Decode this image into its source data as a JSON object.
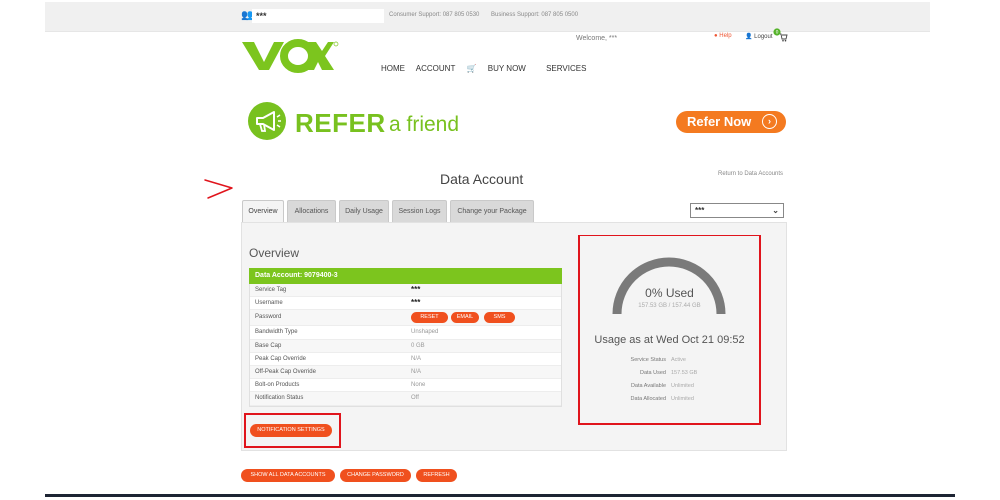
{
  "topbar": {
    "username_masked": "***",
    "consumer_support": "Consumer Support: 087 805 0530",
    "business_support": "Business Support: 087 805 0500"
  },
  "header": {
    "welcome": "Welcome, ***",
    "help_label": "Help",
    "logout_label": "Logout",
    "cart_count": "0"
  },
  "nav": {
    "home": "HOME",
    "account": "ACCOUNT",
    "buy_now": "BUY NOW",
    "services": "SERVICES"
  },
  "banner": {
    "refer_bold": "REFER",
    "refer_light": "a friend",
    "refer_now": "Refer Now"
  },
  "page": {
    "title": "Data Account",
    "return_link": "Return to Data Accounts"
  },
  "tabs": [
    {
      "label": "Overview",
      "active": true
    },
    {
      "label": "Allocations",
      "active": false
    },
    {
      "label": "Daily Usage",
      "active": false
    },
    {
      "label": "Session Logs",
      "active": false
    },
    {
      "label": "Change your Package",
      "active": false
    }
  ],
  "account_select": {
    "value": "***"
  },
  "overview": {
    "heading": "Overview",
    "account_header": "Data Account: 9079400-3",
    "rows": [
      {
        "label": "Service Tag",
        "value": "***"
      },
      {
        "label": "Username",
        "value": "***"
      },
      {
        "label": "Password",
        "value": ""
      },
      {
        "label": "Bandwidth Type",
        "value": "Unshaped"
      },
      {
        "label": "Base Cap",
        "value": "0 GB"
      },
      {
        "label": "Peak Cap Override",
        "value": "N/A"
      },
      {
        "label": "Off-Peak Cap Override",
        "value": "N/A"
      },
      {
        "label": "Bolt-on Products",
        "value": "None"
      },
      {
        "label": "Notification Status",
        "value": "Off"
      }
    ],
    "password_buttons": {
      "reset": "RESET",
      "email": "EMAIL",
      "sms": "SMS"
    },
    "notification_settings": "NOTIFICATION SETTINGS"
  },
  "usage": {
    "percent_label": "0% Used",
    "gb_label": "157.53 GB / 157.44 GB",
    "usage_fraction": 0,
    "as_at": "Usage as at Wed Oct 21 09:52",
    "stats": [
      {
        "key": "Service Status",
        "value": "Active"
      },
      {
        "key": "Data Used",
        "value": "157.53 GB"
      },
      {
        "key": "Data Available",
        "value": "Unlimited"
      },
      {
        "key": "Data Allocated",
        "value": "Unlimited"
      }
    ]
  },
  "footer_buttons": {
    "show_all": "SHOW ALL DATA ACCOUNTS",
    "change_password": "CHANGE PASSWORD",
    "refresh": "REFRESH"
  },
  "colors": {
    "brand_green": "#7cc51e",
    "accent_orange": "#f0501e",
    "annotation_red": "#e0141c"
  }
}
